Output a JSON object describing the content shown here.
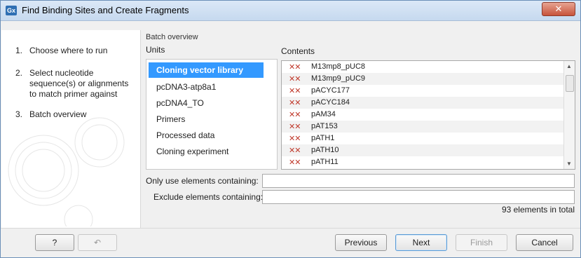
{
  "window": {
    "app_icon": "Gx",
    "title": "Find Binding Sites and Create Fragments",
    "close_label": "✕"
  },
  "steps": [
    {
      "num": "1.",
      "label": "Choose where to run"
    },
    {
      "num": "2.",
      "label": "Select nucleotide sequence(s) or alignments to match primer against"
    },
    {
      "num": "3.",
      "label": "Batch overview"
    }
  ],
  "main": {
    "section_title": "Batch overview",
    "units_label": "Units",
    "contents_label": "Contents",
    "units": [
      "Cloning vector library",
      "pcDNA3-atp8a1",
      "pcDNA4_TO",
      "Primers",
      "Processed data",
      "Cloning experiment"
    ],
    "selected_unit_index": 0,
    "content_icon": "sequence-icon",
    "contents": [
      "M13mp8_pUC8",
      "M13mp9_pUC9",
      "pACYC177",
      "pACYC184",
      "pAM34",
      "pAT153",
      "pATH1",
      "pATH10",
      "pATH11"
    ],
    "only_use_label": "Only use elements containing:",
    "only_use_value": "",
    "exclude_label": "Exclude elements containing:",
    "exclude_value": "",
    "total_text": "93 elements in total"
  },
  "footer": {
    "help_label": "?",
    "previous_label": "Previous",
    "next_label": "Next",
    "finish_label": "Finish",
    "cancel_label": "Cancel"
  }
}
